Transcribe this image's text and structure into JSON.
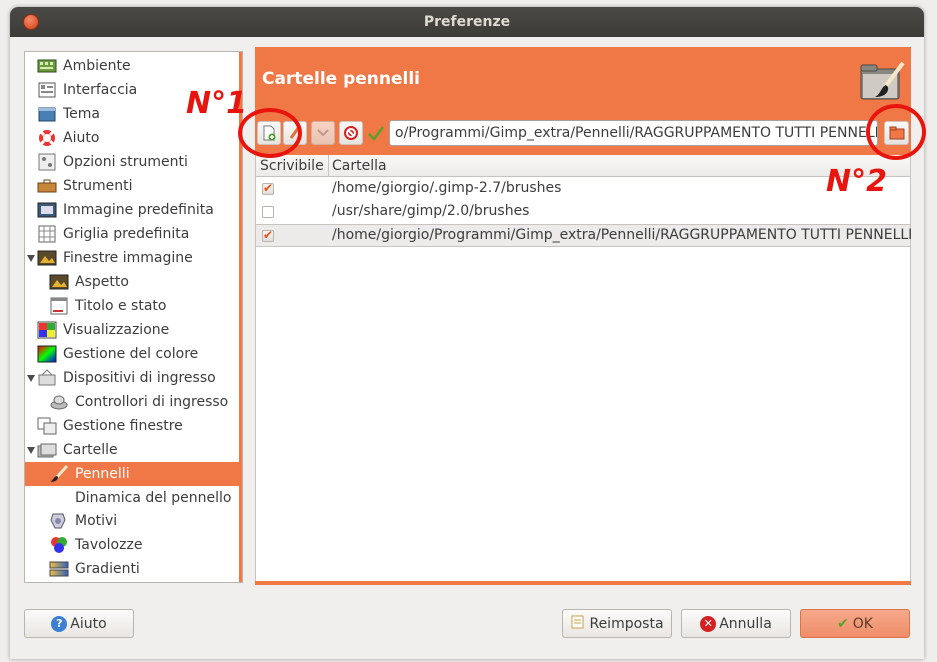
{
  "window": {
    "title": "Preferenze"
  },
  "sidebar": {
    "items": [
      {
        "label": "Ambiente",
        "icon": "ambiente-icon"
      },
      {
        "label": "Interfaccia",
        "icon": "interfaccia-icon"
      },
      {
        "label": "Tema",
        "icon": "tema-icon"
      },
      {
        "label": "Aiuto",
        "icon": "lifebuoy-icon"
      },
      {
        "label": "Opzioni strumenti",
        "icon": "tool-options-icon"
      },
      {
        "label": "Strumenti",
        "icon": "tools-icon"
      },
      {
        "label": "Immagine predefinita",
        "icon": "default-image-icon"
      },
      {
        "label": "Griglia predefinita",
        "icon": "grid-icon"
      },
      {
        "label": "Finestre immagine",
        "icon": "image-windows-icon"
      },
      {
        "label": "Aspetto",
        "icon": "appearance-icon"
      },
      {
        "label": "Titolo e stato",
        "icon": "title-status-icon"
      },
      {
        "label": "Visualizzazione",
        "icon": "display-icon"
      },
      {
        "label": "Gestione del colore",
        "icon": "color-management-icon"
      },
      {
        "label": "Dispositivi di ingresso",
        "icon": "input-devices-icon"
      },
      {
        "label": "Controllori di ingresso",
        "icon": "input-controllers-icon"
      },
      {
        "label": "Gestione finestre",
        "icon": "window-management-icon"
      },
      {
        "label": "Cartelle",
        "icon": "folders-icon"
      },
      {
        "label": "Pennelli",
        "icon": "brush-icon"
      },
      {
        "label": "Dinamica del pennello",
        "icon": "brush-dynamics-icon"
      },
      {
        "label": "Motivi",
        "icon": "patterns-icon"
      },
      {
        "label": "Tavolozze",
        "icon": "palettes-icon"
      },
      {
        "label": "Gradienti",
        "icon": "gradients-icon"
      }
    ]
  },
  "main": {
    "title": "Cartelle pennelli",
    "path_entry": "o/Programmi/Gimp_extra/Pennelli/RAGGRUPPAMENTO TUTTI PENNELLI",
    "columns": [
      "Scrivibile",
      "Cartella"
    ],
    "rows": [
      {
        "writable": true,
        "path": "/home/giorgio/.gimp-2.7/brushes"
      },
      {
        "writable": false,
        "path": "/usr/share/gimp/2.0/brushes"
      },
      {
        "writable": true,
        "path": "/home/giorgio/Programmi/Gimp_extra/Pennelli/RAGGRUPPAMENTO TUTTI PENNELLI"
      }
    ]
  },
  "buttons": {
    "help": "Aiuto",
    "reset": "Reimposta",
    "cancel": "Annulla",
    "ok": "OK"
  },
  "annotations": {
    "one": "N°1",
    "two": "N°2"
  },
  "colors": {
    "accent": "#f07746",
    "annotation": "#e8150f"
  }
}
